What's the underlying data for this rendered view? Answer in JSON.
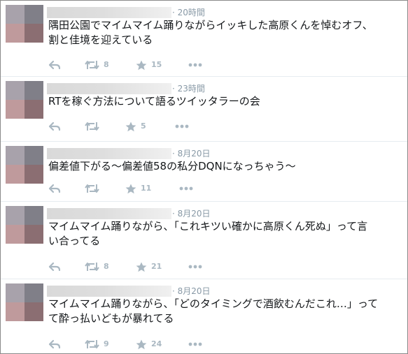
{
  "colors": {
    "timestamp": "#8899a6",
    "action_icon": "#aab8c2",
    "divider": "#e6ecf0",
    "tweet_text": "#14171a"
  },
  "icons": {
    "reply": "reply-arrow-icon",
    "retweet": "retweet-arrows-icon",
    "favorite": "star-icon",
    "more": "more-dots-icon"
  },
  "tweets": [
    {
      "time": "· 20時間",
      "text": "隅田公園でマイムマイム踊りながらイッキした高原くんを悼むオフ、\n割と佳境を迎えている",
      "retweets": "8",
      "favorites": "15"
    },
    {
      "time": "· 23時間",
      "text": "RTを稼ぐ方法について語るツイッタラーの会",
      "retweets": "",
      "favorites": "5"
    },
    {
      "time": "· 8月20日",
      "text": "偏差値下がる〜偏差値58の私分DQNになっちゃう〜",
      "retweets": "",
      "favorites": "11"
    },
    {
      "time": "· 8月20日",
      "text": "マイムマイム踊りながら、「これキツい確かに高原くん死ぬ」って言\nい合ってる",
      "retweets": "8",
      "favorites": "21"
    },
    {
      "time": "· 8月20日",
      "text": "マイムマイム踊りながら、「どのタイミングで酒飲むんだこれ…」って\nて酔っ払いどもが暴れてる",
      "retweets": "9",
      "favorites": "24"
    }
  ]
}
